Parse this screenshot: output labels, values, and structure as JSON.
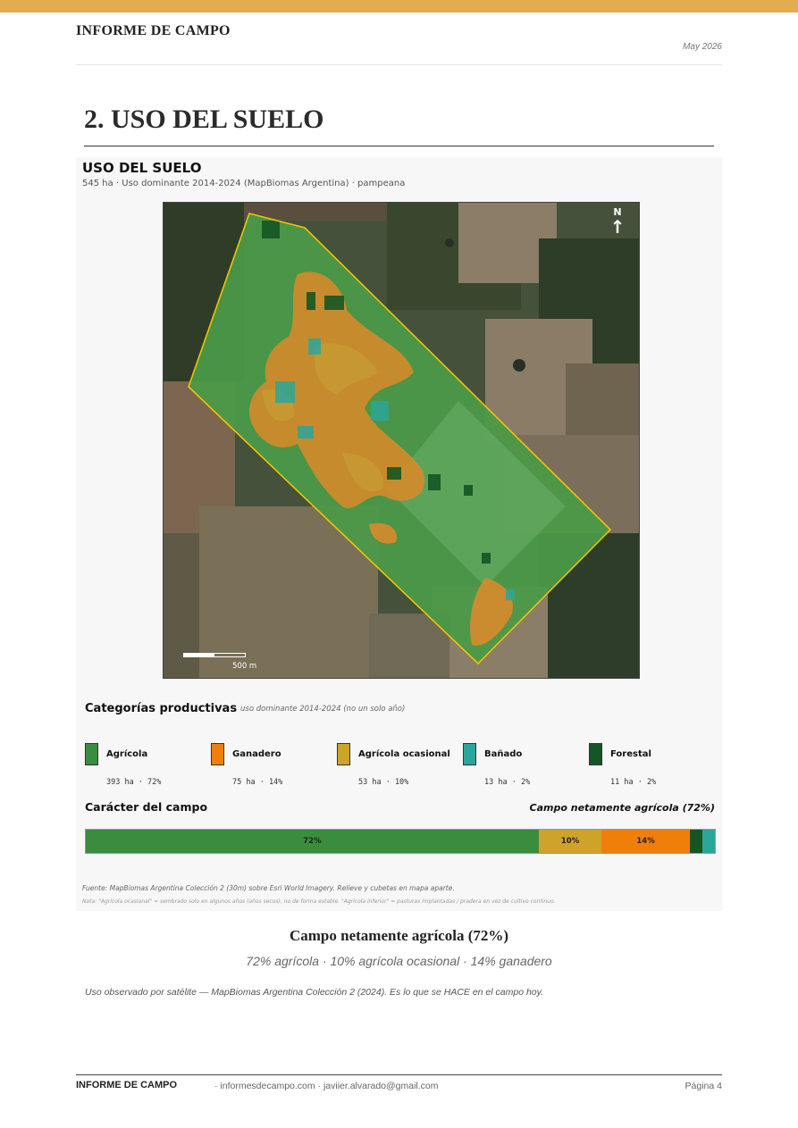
{
  "header": {
    "title": "INFORME DE CAMPO",
    "date": "May 2026"
  },
  "section": {
    "title": "2. USO DEL SUELO"
  },
  "figure": {
    "title": "USO DEL SUELO",
    "subtitle": "545 ha · Uso dominante 2014-2024 (MapBiomas Argentina) · pampeana",
    "north_label": "N",
    "scale_label": "500 m",
    "categories_title": "Categorías productivas",
    "categories_note": "uso dominante 2014-2024 (no un solo año)",
    "legend": [
      {
        "name": "Agrícola",
        "value": "393 ha · 72%",
        "color": "#3a8d3c"
      },
      {
        "name": "Ganadero",
        "value": "75 ha · 14%",
        "color": "#f07f0a"
      },
      {
        "name": "Agrícola ocasional",
        "value": "53 ha · 10%",
        "color": "#cfa22a"
      },
      {
        "name": "Bañado",
        "value": "13 ha · 2%",
        "color": "#2aa69a"
      },
      {
        "name": "Forestal",
        "value": "11 ha · 2%",
        "color": "#145523"
      }
    ],
    "character_title": "Carácter del campo",
    "character_verdict": "Campo netamente agrícola (72%)",
    "bar": [
      {
        "label": "72%",
        "pct": 72,
        "color": "#3a8d3c"
      },
      {
        "label": "10%",
        "pct": 10,
        "color": "#cfa22a"
      },
      {
        "label": "14%",
        "pct": 14,
        "color": "#f07f0a"
      },
      {
        "label": "",
        "pct": 2,
        "color": "#145523"
      },
      {
        "label": "",
        "pct": 2,
        "color": "#2aa69a"
      }
    ],
    "source": "Fuente: MapBiomas Argentina Colección 2 (30m) sobre Esri World Imagery. Relieve y cubetas en mapa aparte.",
    "note": "Nota: \"Agrícola ocasional\" = sembrado solo en algunos años (años secos), no de forma estable. \"Agrícola inferior\" = pasturas implantadas / pradera en vez de cultivo continuo."
  },
  "conclusion": {
    "title": "Campo netamente agrícola (72%)",
    "subtitle": "72% agrícola · 10% agrícola ocasional · 14% ganadero"
  },
  "source_note": "Uso observado por satélite — MapBiomas Argentina Colección 2 (2024). Es lo que se HACE en el campo hoy.",
  "footer": {
    "brand": "INFORME DE CAMPO",
    "links": "· informesdecampo.com · javiier.alvarado@gmail.com",
    "page": "Página 4"
  }
}
